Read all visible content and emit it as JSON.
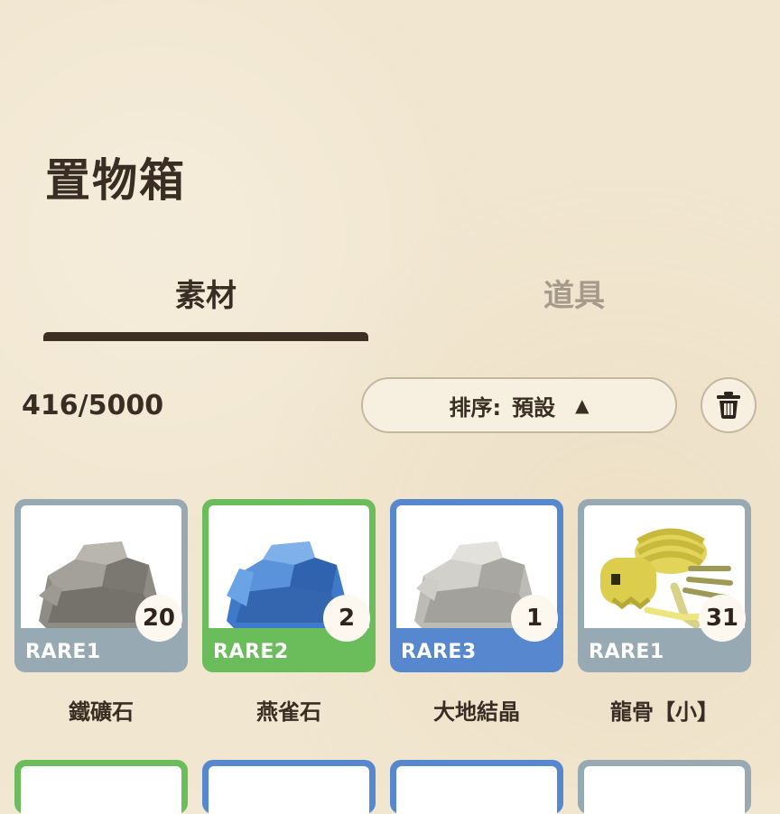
{
  "header": {
    "title": "置物箱"
  },
  "tabs": [
    {
      "label": "素材",
      "active": true
    },
    {
      "label": "道具",
      "active": false
    }
  ],
  "toolbar": {
    "capacity": "416/5000",
    "sort_label": "排序:",
    "sort_value": "預設",
    "sort_direction_icon": "triangle-up-icon",
    "trash_icon": "trash-icon"
  },
  "items": [
    {
      "name": "鐵礦石",
      "rarity": "RARE1",
      "quantity": "20",
      "icon": "gray-ore-icon",
      "color": "#97aab3"
    },
    {
      "name": "燕雀石",
      "rarity": "RARE2",
      "quantity": "2",
      "icon": "blue-ore-icon",
      "color": "#6bbd5c"
    },
    {
      "name": "大地結晶",
      "rarity": "RARE3",
      "quantity": "1",
      "icon": "white-crystal-icon",
      "color": "#5787cf"
    },
    {
      "name": "龍骨【小】",
      "rarity": "RARE1",
      "quantity": "31",
      "icon": "yellow-dragon-bone-icon",
      "color": "#97aab3"
    }
  ],
  "colors": {
    "rare1": "#97aab3",
    "rare2": "#6bbd5c",
    "rare3": "#5787cf",
    "text": "#3a2e24"
  }
}
